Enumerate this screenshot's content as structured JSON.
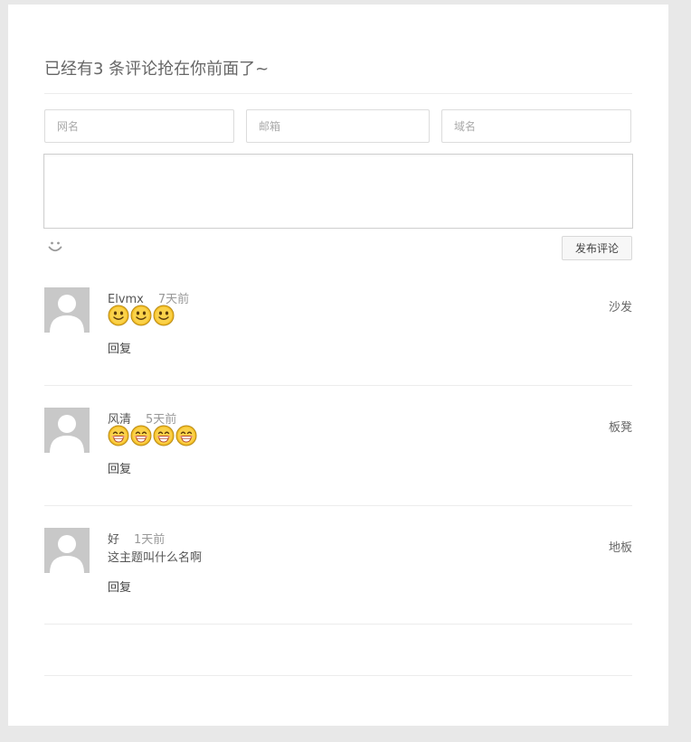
{
  "comments_section": {
    "heading": "已经有3 条评论抢在你前面了~"
  },
  "form": {
    "name_placeholder": "网名",
    "email_placeholder": "邮箱",
    "site_placeholder": "域名",
    "submit_label": "发布评论",
    "emoji_icon": "smile-icon"
  },
  "comments": [
    {
      "author": "Elvmx",
      "time": "7天前",
      "floor": "沙发",
      "emojis": [
        "smiling-face-emoji",
        "smiling-face-emoji",
        "smiling-face-emoji"
      ],
      "text": "",
      "reply_label": "回复"
    },
    {
      "author": "风清",
      "time": "5天前",
      "floor": "板凳",
      "emojis": [
        "grinning-face-emoji",
        "grinning-face-emoji",
        "grinning-face-emoji",
        "grinning-face-emoji"
      ],
      "text": "",
      "reply_label": "回复"
    },
    {
      "author": "好",
      "time": "1天前",
      "floor": "地板",
      "emojis": [],
      "text": "这主题叫什么名啊",
      "reply_label": "回复"
    }
  ],
  "colors": {
    "page_background": "#e8e8e8",
    "card_background": "#ffffff",
    "emoji_yellow": "#f5c02a"
  }
}
